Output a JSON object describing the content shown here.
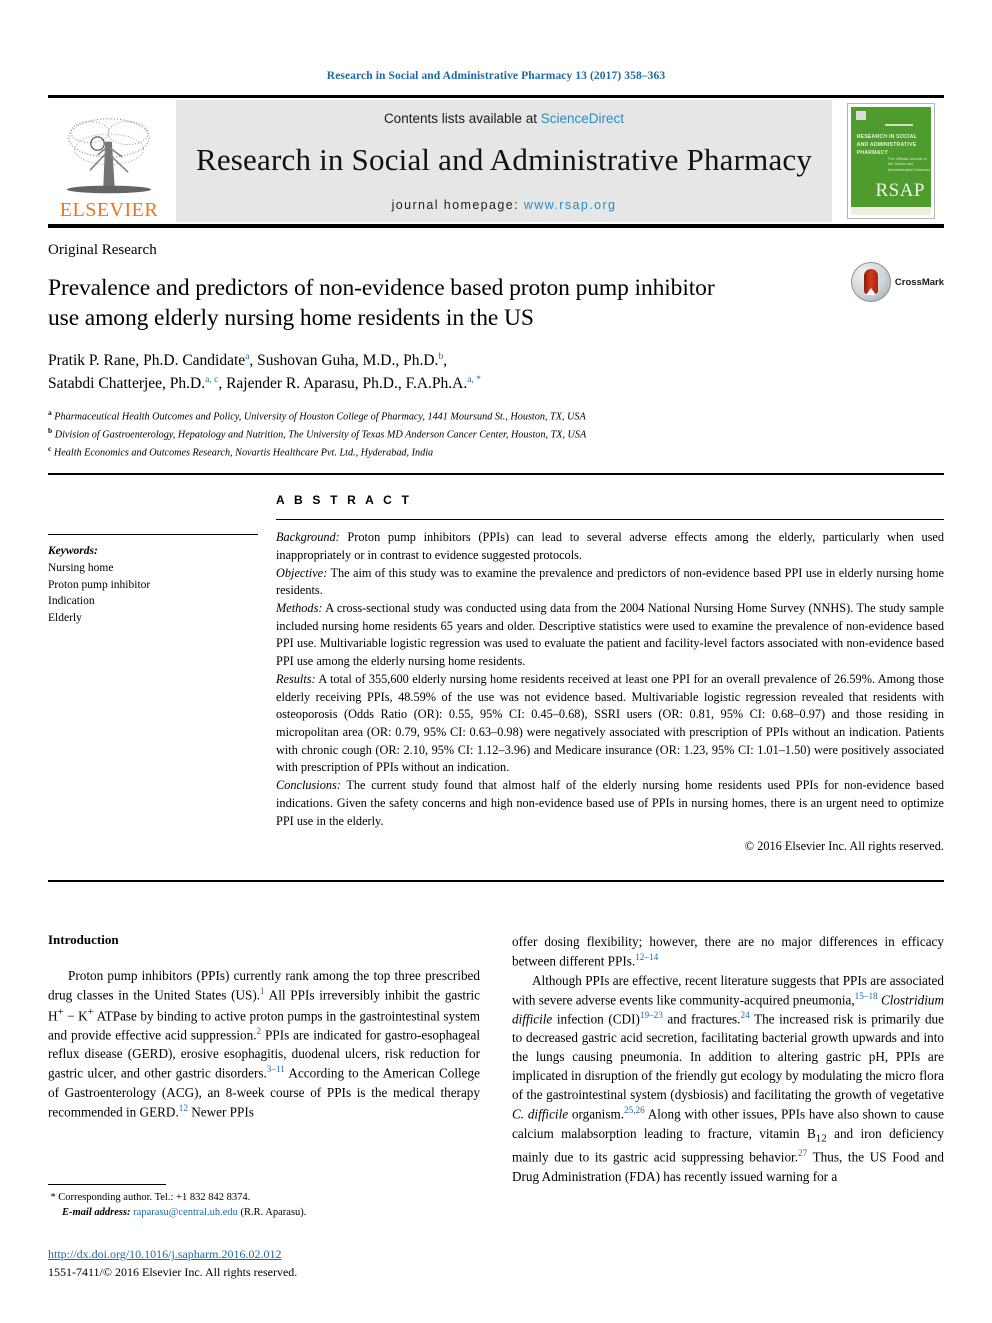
{
  "running_head": "Research in Social and Administrative Pharmacy 13 (2017) 358–363",
  "masthead": {
    "publisher_name": "ELSEVIER",
    "contents_prefix": "Contents lists available at ",
    "contents_link": "ScienceDirect",
    "journal_title": "Research in Social and Administrative Pharmacy",
    "homepage_prefix": "journal homepage: ",
    "homepage_url": "www.rsap.org",
    "cover": {
      "journal_title": "RESEARCH IN SOCIAL AND ADMINISTRATIVE PHARMACY",
      "subtitle": "The Official Journal of the Social and Administrative Sciences",
      "acronym": "RSAP"
    }
  },
  "article": {
    "section_kind": "Original Research",
    "title": "Prevalence and predictors of non-evidence based proton pump inhibitor use among elderly nursing home residents in the US",
    "authors": [
      {
        "name": "Pratik P. Rane, Ph.D. Candidate",
        "marks": "a"
      },
      {
        "name": "Sushovan Guha, M.D., Ph.D.",
        "marks": "b"
      },
      {
        "name": "Satabdi Chatterjee, Ph.D.",
        "marks": "a, c"
      },
      {
        "name": "Rajender R. Aparasu, Ph.D., F.A.Ph.A.",
        "marks": "a, *"
      }
    ],
    "affiliations": [
      {
        "mark": "a",
        "text": "Pharmaceutical Health Outcomes and Policy, University of Houston College of Pharmacy, 1441 Moursund St., Houston, TX, USA"
      },
      {
        "mark": "b",
        "text": "Division of Gastroenterology, Hepatology and Nutrition, The University of Texas MD Anderson Cancer Center, Houston, TX, USA"
      },
      {
        "mark": "c",
        "text": "Health Economics and Outcomes Research, Novartis Healthcare Pvt. Ltd., Hyderabad, India"
      }
    ],
    "crossmark_label": "CrossMark"
  },
  "keywords": {
    "heading": "Keywords:",
    "items": [
      "Nursing home",
      "Proton pump inhibitor",
      "Indication",
      "Elderly"
    ]
  },
  "abstract": {
    "heading": "A B S T R A C T",
    "sections": [
      {
        "label": "Background:",
        "text": " Proton pump inhibitors (PPIs) can lead to several adverse effects among the elderly, particularly when used inappropriately or in contrast to evidence suggested protocols."
      },
      {
        "label": "Objective:",
        "text": " The aim of this study was to examine the prevalence and predictors of non-evidence based PPI use in elderly nursing home residents."
      },
      {
        "label": "Methods:",
        "text": " A cross-sectional study was conducted using data from the 2004 National Nursing Home Survey (NNHS). The study sample included nursing home residents 65 years and older. Descriptive statistics were used to examine the prevalence of non-evidence based PPI use. Multivariable logistic regression was used to evaluate the patient and facility-level factors associated with non-evidence based PPI use among the elderly nursing home residents."
      },
      {
        "label": "Results:",
        "text": " A total of 355,600 elderly nursing home residents received at least one PPI for an overall prevalence of 26.59%. Among those elderly receiving PPIs, 48.59% of the use was not evidence based. Multivariable logistic regression revealed that residents with osteoporosis (Odds Ratio (OR): 0.55, 95% CI: 0.45–0.68), SSRI users (OR: 0.81, 95% CI: 0.68–0.97) and those residing in micropolitan area (OR: 0.79, 95% CI: 0.63–0.98) were negatively associated with prescription of PPIs without an indication. Patients with chronic cough (OR: 2.10, 95% CI: 1.12–3.96) and Medicare insurance (OR: 1.23, 95% CI: 1.01–1.50) were positively associated with prescription of PPIs without an indication."
      },
      {
        "label": "Conclusions:",
        "text": " The current study found that almost half of the elderly nursing home residents used PPIs for non-evidence based indications. Given the safety concerns and high non-evidence based use of PPIs in nursing homes, there is an urgent need to optimize PPI use in the elderly."
      }
    ],
    "copyright": "© 2016 Elsevier Inc. All rights reserved."
  },
  "body": {
    "left_heading": "Introduction",
    "left_paragraph_1": {
      "a": "Proton pump inhibitors (PPIs) currently rank among the top three prescribed drug classes in the United States (US).",
      "r1": "1",
      "b": " All PPIs irreversibly inhibit the gastric H",
      "sup1": "+",
      "c": " − K",
      "sup2": "+",
      "d": " ATPase by binding to active proton pumps in the gastrointestinal system and provide effective acid suppression.",
      "r2": "2",
      "e": " PPIs are indicated for gastro-esophageal reflux disease (GERD), erosive esophagitis, duodenal ulcers, risk reduction for gastric ulcer, and other gastric disorders.",
      "r3": "3–11",
      "f": " According to the American College of Gastroenterology (ACG), an 8-week course of PPIs is the medical therapy recommended in GERD.",
      "r4": "12",
      "g": " Newer PPIs"
    },
    "right_paragraph_1": {
      "a": "offer dosing flexibility; however, there are no major differences in efficacy between different PPIs.",
      "r1": "12–14"
    },
    "right_paragraph_2": {
      "a": "Although PPIs are effective, recent literature suggests that PPIs are associated with severe adverse events like community-acquired pneumonia,",
      "r1": "15–18",
      "b": " Clostridium difficile",
      "c": " infection (CDI)",
      "r2": "19–23",
      "d": " and fractures.",
      "r3": "24",
      "e": " The increased risk is primarily due to decreased gastric acid secretion, facilitating bacterial growth upwards and into the lungs causing pneumonia. In addition to altering gastric pH, PPIs are implicated in disruption of the friendly gut ecology by modulating the micro flora of the gastrointestinal system (dysbiosis) and facilitating the growth of vegetative ",
      "f": "C. difficile",
      "g": " organism.",
      "r4": "25,26",
      "h": " Along with other issues, PPIs have also shown to cause calcium malabsorption leading to fracture, vitamin B",
      "sub1": "12",
      "i": " and iron deficiency mainly due to its gastric acid suppressing behavior.",
      "r5": "27",
      "j": " Thus, the US Food and Drug Administration (FDA) has recently issued warning for a"
    }
  },
  "footer": {
    "corresponding_marker": "*",
    "corresponding_text": "Corresponding author. Tel.: +1 832 842 8374.",
    "email_label": "E-mail address:",
    "email": "raparasu@central.uh.edu",
    "email_attribution": "(R.R. Aparasu).",
    "doi": "http://dx.doi.org/10.1016/j.sapharm.2016.02.012",
    "issn_line": "1551-7411/© 2016 Elsevier Inc. All rights reserved."
  }
}
